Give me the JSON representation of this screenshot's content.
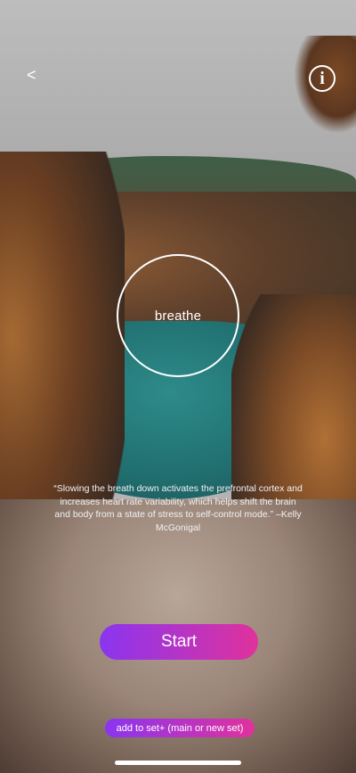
{
  "nav": {
    "back_label": "<",
    "info_label": "i"
  },
  "breathe": {
    "label": "breathe"
  },
  "quote": {
    "text": "“Slowing the breath down activates the prefrontal cortex and increases heart rate variability, which helps shift the brain and body from a state of stress to self-control mode.” –Kelly McGonigal"
  },
  "actions": {
    "start_label": "Start",
    "add_to_set_label": "add to set+ (main or new set)"
  },
  "colors": {
    "button_gradient_start": "#8a35f0",
    "button_gradient_end": "#e0329c",
    "lake": "#2d8b89"
  },
  "icons": {
    "back": "chevron-left-icon",
    "info": "info-icon"
  }
}
